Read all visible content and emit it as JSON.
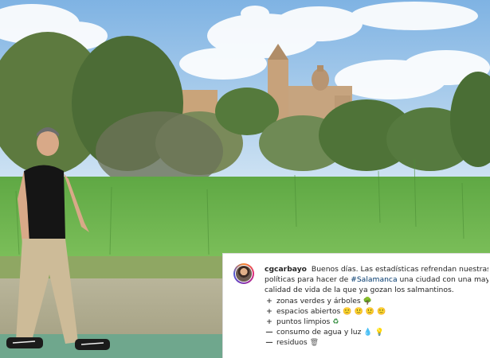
{
  "post": {
    "username": "cgcarbayo",
    "caption_lead": "Buenos días. Las estadísticas refrendan nuestras",
    "caption_line2_pre": "políticas para hacer de",
    "hashtag": "#Salamanca",
    "caption_line2_post": "una ciudad con una mayor",
    "caption_line3": "calidad de vida de la que ya gozan los salmantinos.",
    "items": [
      {
        "sign": "+",
        "text": "zonas verdes y árboles",
        "icons": [
          "tree-icon"
        ]
      },
      {
        "sign": "+",
        "text": "espacios abiertos",
        "icons": [
          "face-icon",
          "face-icon",
          "face-icon",
          "face-icon"
        ]
      },
      {
        "sign": "+",
        "text": "puntos limpios",
        "icons": [
          "recycle-icon"
        ]
      },
      {
        "sign": "—",
        "text": "consumo de agua y luz",
        "icons": [
          "water-drop-icon",
          "light-bulb-icon"
        ]
      },
      {
        "sign": "—",
        "text": "residuos",
        "icons": [
          "trash-can-icon"
        ]
      }
    ]
  },
  "colors": {
    "sky": "#9cc7ea",
    "grass": "#6cb24d",
    "cathedral": "#c9a47a",
    "hashtag": "#00376b"
  }
}
